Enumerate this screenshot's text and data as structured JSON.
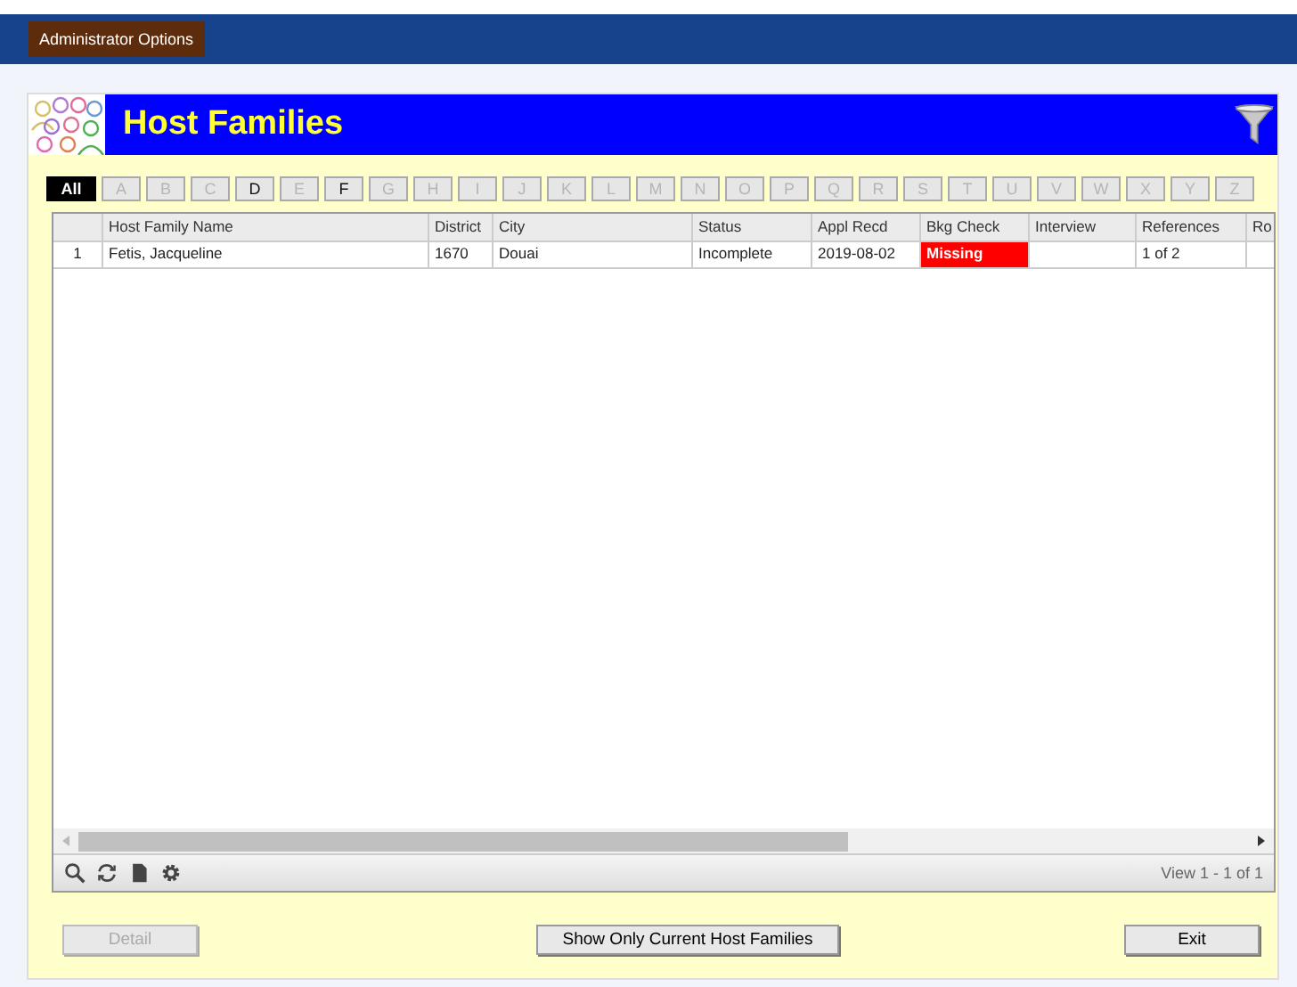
{
  "top_bar": {
    "button": "Administrator Options"
  },
  "header": {
    "title": "Host Families"
  },
  "letters": [
    {
      "label": "All",
      "selected": true,
      "enabled": true
    },
    {
      "label": "A",
      "selected": false,
      "enabled": false
    },
    {
      "label": "B",
      "selected": false,
      "enabled": false
    },
    {
      "label": "C",
      "selected": false,
      "enabled": false
    },
    {
      "label": "D",
      "selected": false,
      "enabled": true
    },
    {
      "label": "E",
      "selected": false,
      "enabled": false
    },
    {
      "label": "F",
      "selected": false,
      "enabled": true
    },
    {
      "label": "G",
      "selected": false,
      "enabled": false
    },
    {
      "label": "H",
      "selected": false,
      "enabled": false
    },
    {
      "label": "I",
      "selected": false,
      "enabled": false
    },
    {
      "label": "J",
      "selected": false,
      "enabled": false
    },
    {
      "label": "K",
      "selected": false,
      "enabled": false
    },
    {
      "label": "L",
      "selected": false,
      "enabled": false
    },
    {
      "label": "M",
      "selected": false,
      "enabled": false
    },
    {
      "label": "N",
      "selected": false,
      "enabled": false
    },
    {
      "label": "O",
      "selected": false,
      "enabled": false
    },
    {
      "label": "P",
      "selected": false,
      "enabled": false
    },
    {
      "label": "Q",
      "selected": false,
      "enabled": false
    },
    {
      "label": "R",
      "selected": false,
      "enabled": false
    },
    {
      "label": "S",
      "selected": false,
      "enabled": false
    },
    {
      "label": "T",
      "selected": false,
      "enabled": false
    },
    {
      "label": "U",
      "selected": false,
      "enabled": false
    },
    {
      "label": "V",
      "selected": false,
      "enabled": false
    },
    {
      "label": "W",
      "selected": false,
      "enabled": false
    },
    {
      "label": "X",
      "selected": false,
      "enabled": false
    },
    {
      "label": "Y",
      "selected": false,
      "enabled": false
    },
    {
      "label": "Z",
      "selected": false,
      "enabled": false
    }
  ],
  "table": {
    "columns": [
      "Host Family Name",
      "District",
      "City",
      "Status",
      "Appl Recd",
      "Bkg Check",
      "Interview",
      "References",
      "Ro"
    ],
    "rows": [
      {
        "number": "1",
        "cells": [
          {
            "text": "Fetis, Jacqueline"
          },
          {
            "text": "1670"
          },
          {
            "text": "Douai"
          },
          {
            "text": "Incomplete"
          },
          {
            "text": "2019-08-02"
          },
          {
            "text": "Missing",
            "color": "#ff0000"
          },
          {
            "text": ""
          },
          {
            "text": "1 of 2"
          },
          {
            "text": ""
          }
        ]
      }
    ]
  },
  "pager": {
    "text": "View 1 - 1 of 1"
  },
  "buttons": [
    {
      "label": "Detail",
      "disabled": true
    },
    {
      "label": "Show Only Current Host Families",
      "disabled": false
    },
    {
      "label": "Exit",
      "disabled": false
    }
  ]
}
